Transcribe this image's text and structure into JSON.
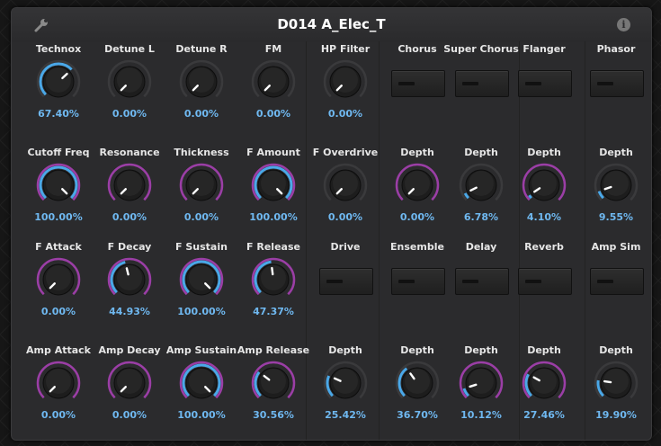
{
  "window": {
    "title": "D014 A_Elec_T",
    "info_glyph": "i"
  },
  "colors": {
    "blue_arc": "#4aa8e8",
    "purple_arc": "#9b3ea6",
    "value_text": "#6fb8f0"
  },
  "rows": [
    [
      {
        "type": "knob",
        "label": "Technox",
        "value": "67.40%",
        "level": 0.674,
        "ring": "blue"
      },
      {
        "type": "knob",
        "label": "Detune L",
        "value": "0.00%",
        "level": 0.0,
        "ring": "none"
      },
      {
        "type": "knob",
        "label": "Detune R",
        "value": "0.00%",
        "level": 0.0,
        "ring": "none"
      },
      {
        "type": "knob",
        "label": "FM",
        "value": "0.00%",
        "level": 0.0,
        "ring": "none"
      },
      {
        "type": "knob",
        "label": "HP Filter",
        "value": "0.00%",
        "level": 0.0,
        "ring": "none"
      },
      {
        "type": "switch",
        "label": "Chorus"
      },
      {
        "type": "switch",
        "label": "Super Chorus"
      },
      {
        "type": "switch",
        "label": "Flanger"
      },
      {
        "type": "switch",
        "label": "Phasor"
      }
    ],
    [
      {
        "type": "knob",
        "label": "Cutoff Freq",
        "value": "100.00%",
        "level": 1.0,
        "ring": "purple-blue"
      },
      {
        "type": "knob",
        "label": "Resonance",
        "value": "0.00%",
        "level": 0.0,
        "ring": "purple"
      },
      {
        "type": "knob",
        "label": "Thickness",
        "value": "0.00%",
        "level": 0.0,
        "ring": "purple"
      },
      {
        "type": "knob",
        "label": "F Amount",
        "value": "100.00%",
        "level": 1.0,
        "ring": "purple-blue"
      },
      {
        "type": "knob",
        "label": "F Overdrive",
        "value": "0.00%",
        "level": 0.0,
        "ring": "none"
      },
      {
        "type": "knob",
        "label": "Depth",
        "value": "0.00%",
        "level": 0.0,
        "ring": "purple"
      },
      {
        "type": "knob",
        "label": "Depth",
        "value": "6.78%",
        "level": 0.0678,
        "ring": "none"
      },
      {
        "type": "knob",
        "label": "Depth",
        "value": "4.10%",
        "level": 0.041,
        "ring": "purple"
      },
      {
        "type": "knob",
        "label": "Depth",
        "value": "9.55%",
        "level": 0.0955,
        "ring": "none"
      }
    ],
    [
      {
        "type": "knob",
        "label": "F Attack",
        "value": "0.00%",
        "level": 0.0,
        "ring": "purple"
      },
      {
        "type": "knob",
        "label": "F Decay",
        "value": "44.93%",
        "level": 0.4493,
        "ring": "purple"
      },
      {
        "type": "knob",
        "label": "F Sustain",
        "value": "100.00%",
        "level": 1.0,
        "ring": "purple-blue"
      },
      {
        "type": "knob",
        "label": "F Release",
        "value": "47.37%",
        "level": 0.4737,
        "ring": "purple"
      },
      {
        "type": "switch",
        "label": "Drive"
      },
      {
        "type": "switch",
        "label": "Ensemble"
      },
      {
        "type": "switch",
        "label": "Delay"
      },
      {
        "type": "switch",
        "label": "Reverb"
      },
      {
        "type": "switch",
        "label": "Amp Sim"
      }
    ],
    [
      {
        "type": "knob",
        "label": "Amp Attack",
        "value": "0.00%",
        "level": 0.0,
        "ring": "purple"
      },
      {
        "type": "knob",
        "label": "Amp Decay",
        "value": "0.00%",
        "level": 0.0,
        "ring": "purple"
      },
      {
        "type": "knob",
        "label": "Amp Sustain",
        "value": "100.00%",
        "level": 1.0,
        "ring": "purple-blue"
      },
      {
        "type": "knob",
        "label": "Amp Release",
        "value": "30.56%",
        "level": 0.3056,
        "ring": "purple"
      },
      {
        "type": "knob",
        "label": "Depth",
        "value": "25.42%",
        "level": 0.2542,
        "ring": "none"
      },
      {
        "type": "knob",
        "label": "Depth",
        "value": "36.70%",
        "level": 0.367,
        "ring": "none"
      },
      {
        "type": "knob",
        "label": "Depth",
        "value": "10.12%",
        "level": 0.1012,
        "ring": "purple"
      },
      {
        "type": "knob",
        "label": "Depth",
        "value": "27.46%",
        "level": 0.2746,
        "ring": "purple"
      },
      {
        "type": "knob",
        "label": "Depth",
        "value": "19.90%",
        "level": 0.199,
        "ring": "none"
      }
    ]
  ]
}
